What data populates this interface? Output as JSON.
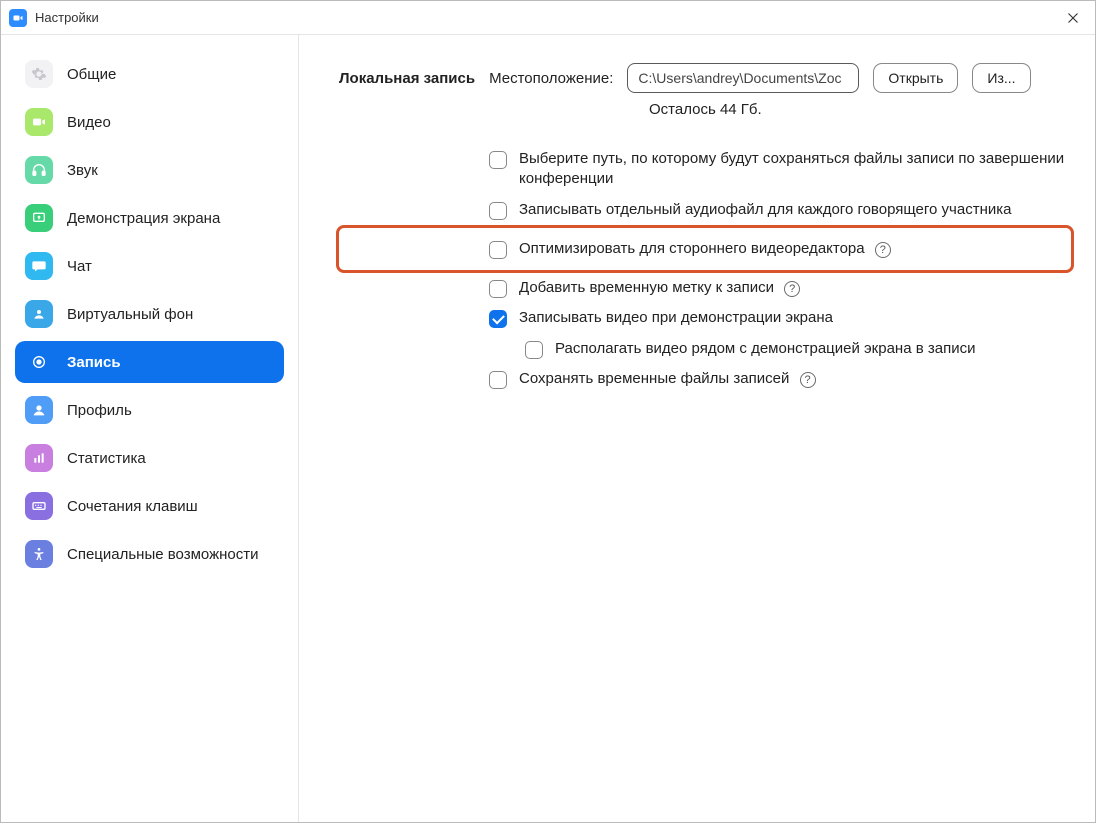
{
  "window": {
    "title": "Настройки"
  },
  "sidebar": {
    "items": [
      {
        "key": "general",
        "label": "Общие"
      },
      {
        "key": "video",
        "label": "Видео"
      },
      {
        "key": "audio",
        "label": "Звук"
      },
      {
        "key": "share",
        "label": "Демонстрация экрана"
      },
      {
        "key": "chat",
        "label": "Чат"
      },
      {
        "key": "vb",
        "label": "Виртуальный фон"
      },
      {
        "key": "recording",
        "label": "Запись",
        "active": true
      },
      {
        "key": "profile",
        "label": "Профиль"
      },
      {
        "key": "stats",
        "label": "Статистика"
      },
      {
        "key": "shortcuts",
        "label": "Сочетания клавиш"
      },
      {
        "key": "a11y",
        "label": "Специальные возможности"
      }
    ]
  },
  "recording": {
    "section_title": "Локальная запись",
    "location_label": "Местоположение:",
    "path_value": "C:\\Users\\andrey\\Documents\\Zoc",
    "open_button": "Открыть",
    "change_button": "Из...",
    "remaining": "Осталось 44 Гб.",
    "options": [
      {
        "id": "choose_path",
        "checked": false,
        "label": "Выберите путь, по которому будут сохраняться файлы записи по завершении конференции",
        "help": false
      },
      {
        "id": "separate_audio",
        "checked": false,
        "label": "Записывать отдельный аудиофайл для каждого говорящего участника",
        "help": false
      },
      {
        "id": "optimize_3rd",
        "checked": false,
        "label": "Оптимизировать для стороннего видеоредактора",
        "help": true,
        "highlighted": true
      },
      {
        "id": "timestamp",
        "checked": false,
        "label": "Добавить временную метку к записи",
        "help": true
      },
      {
        "id": "record_share",
        "checked": true,
        "label": "Записывать видео при демонстрации экрана",
        "help": false
      },
      {
        "id": "video_beside_share",
        "checked": false,
        "label": "Располагать видео рядом с демонстрацией экрана в записи",
        "help": false,
        "sub": true
      },
      {
        "id": "keep_temp",
        "checked": false,
        "label": "Сохранять временные файлы записей",
        "help": true
      }
    ]
  }
}
